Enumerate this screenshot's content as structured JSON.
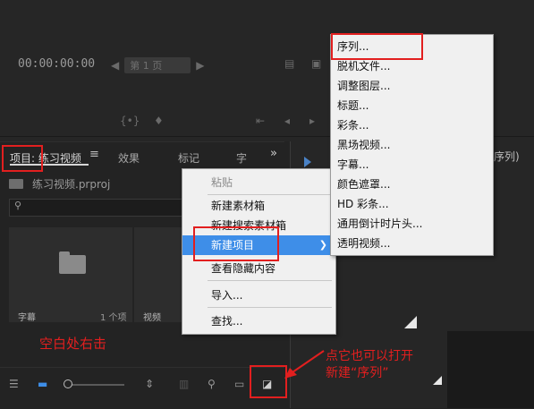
{
  "monitor": {
    "timecode": "00:00:00:00",
    "page_selector": "第 1 页"
  },
  "project_panel": {
    "tabs": [
      {
        "label": "项目: 练习视频",
        "active": true
      },
      {
        "label": "效果"
      },
      {
        "label": "标记"
      },
      {
        "label": "字"
      }
    ],
    "tab_menu_icon": "≡",
    "tab_overflow_icon": "»",
    "project_file": "练习视频.prproj",
    "bins": [
      {
        "label": "字幕",
        "count": "1 个项"
      },
      {
        "label": "视频"
      }
    ]
  },
  "timeline_panel": {
    "tab_label": "序列)"
  },
  "context_menu": {
    "items": [
      {
        "label": "粘贴",
        "disabled": true
      },
      {
        "label": "新建素材箱"
      },
      {
        "label": "新建搜索素材箱"
      },
      {
        "label": "新建项目",
        "highlighted": true,
        "has_submenu": true
      },
      {
        "label": "查看隐藏内容"
      },
      {
        "label": "导入..."
      },
      {
        "label": "查找..."
      }
    ]
  },
  "submenu": {
    "items": [
      {
        "label": "序列..."
      },
      {
        "label": "脱机文件..."
      },
      {
        "label": "调整图层..."
      },
      {
        "label": "标题..."
      },
      {
        "label": "彩条..."
      },
      {
        "label": "黑场视频..."
      },
      {
        "label": "字幕..."
      },
      {
        "label": "颜色遮罩..."
      },
      {
        "label": "HD 彩条..."
      },
      {
        "label": "通用倒计时片头..."
      },
      {
        "label": "透明视频..."
      }
    ]
  },
  "annotations": {
    "right_click_hint": "空白处右击",
    "button_hint_line1": "点它也可以打开",
    "button_hint_line2": "新建“序列”"
  },
  "colors": {
    "highlight": "#3e8ee8",
    "annotation_red": "#e21f1f",
    "panel_bg": "#232323"
  }
}
